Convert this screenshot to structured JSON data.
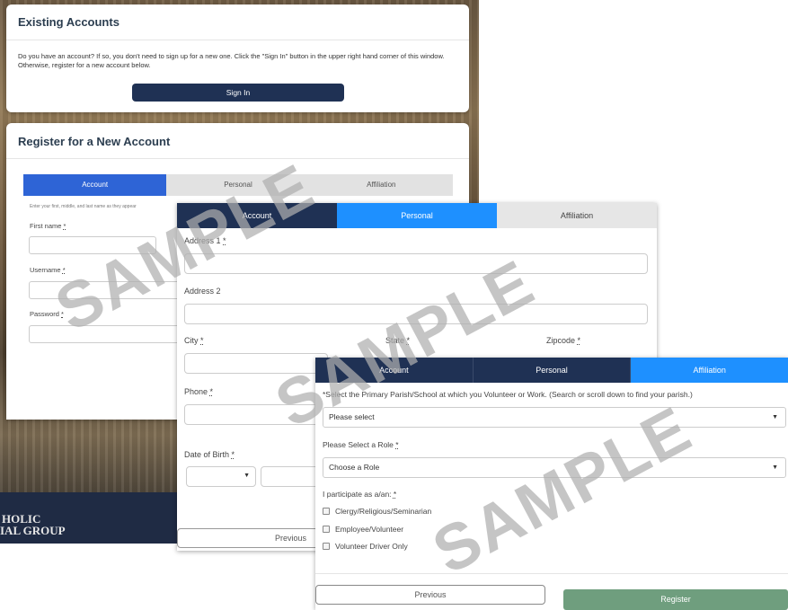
{
  "existing": {
    "title": "Existing Accounts",
    "text": "Do you have an account? If so, you don't need to sign up for a new one. Click the \"Sign In\" button in the upper right hand corner of this window. Otherwise, register for a new account below.",
    "signin_label": "Sign In"
  },
  "register": {
    "title": "Register for a New Account",
    "tabs": [
      "Account",
      "Personal",
      "Affiliation"
    ],
    "hint": "Enter your first, middle, and last name as they appear",
    "first_name_label": "First name",
    "username_label": "Username",
    "password_label": "Password",
    "required_mark": "*"
  },
  "personal": {
    "tabs": [
      "Account",
      "Personal",
      "Affiliation"
    ],
    "address1_label": "Address 1",
    "address2_label": "Address 2",
    "city_label": "City",
    "state_label": "State",
    "zip_label": "Zipcode",
    "phone_label": "Phone",
    "dob_label": "Date of Birth",
    "previous_label": "Previous",
    "caret": "▼"
  },
  "affiliation": {
    "tabs": [
      "Account",
      "Personal",
      "Affiliation"
    ],
    "parish_label": "*Select the Primary Parish/School at which you Volunteer or Work. (Search or scroll down to find your parish.)",
    "parish_value": "Please select",
    "role_label": "Please Select a Role",
    "role_value": "Choose a Role",
    "participate_label": "I participate as a/an:",
    "options": [
      "Clergy/Religious/Seminarian",
      "Employee/Volunteer",
      "Volunteer Driver Only"
    ],
    "previous_label": "Previous",
    "register_label": "Register",
    "caret": "▼"
  },
  "footer": {
    "logo_line1": "HOLIC",
    "logo_line2": "IAL GROUP"
  },
  "watermark": "SAMPLE"
}
